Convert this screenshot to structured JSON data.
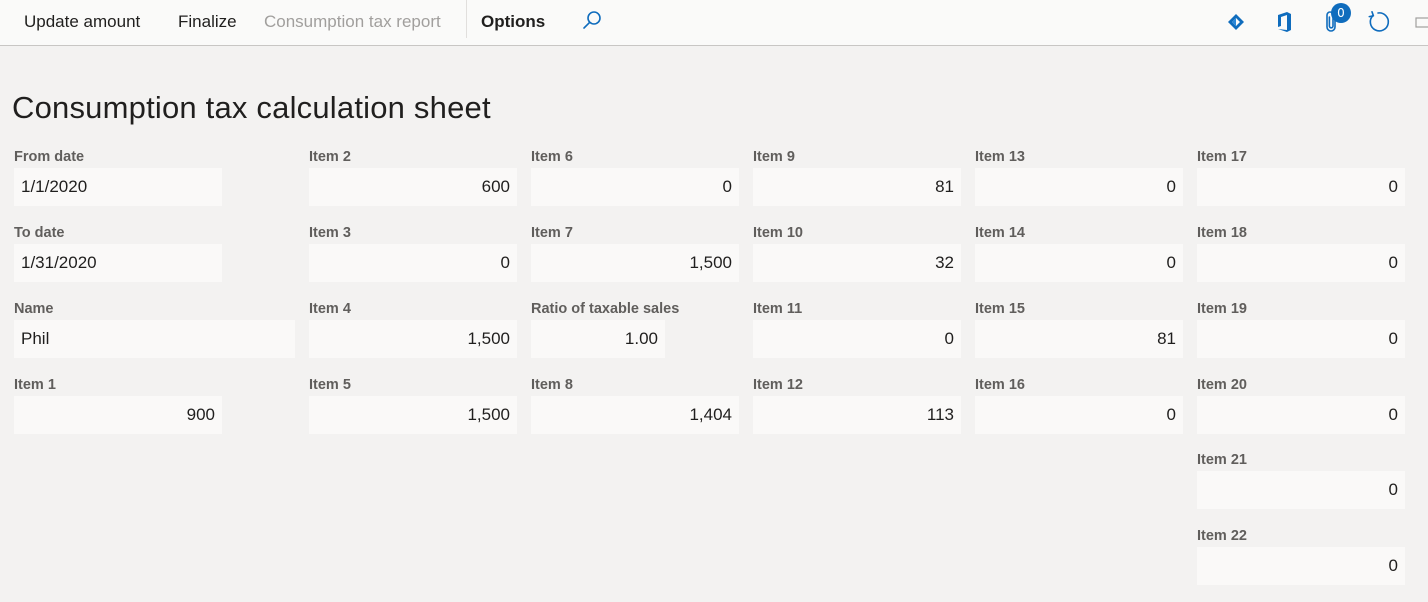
{
  "toolbar": {
    "update_amount": "Update amount",
    "finalize": "Finalize",
    "consumption_tax_report": "Consumption tax report",
    "options": "Options",
    "attachments_count": "0"
  },
  "page": {
    "title": "Consumption tax calculation sheet"
  },
  "fields": {
    "from_date": {
      "label": "From date",
      "value": "1/1/2020"
    },
    "to_date": {
      "label": "To date",
      "value": "1/31/2020"
    },
    "name": {
      "label": "Name",
      "value": "Phil"
    },
    "item1": {
      "label": "Item 1",
      "value": "900"
    },
    "item2": {
      "label": "Item 2",
      "value": "600"
    },
    "item3": {
      "label": "Item 3",
      "value": "0"
    },
    "item4": {
      "label": "Item 4",
      "value": "1,500"
    },
    "item5": {
      "label": "Item 5",
      "value": "1,500"
    },
    "item6": {
      "label": "Item 6",
      "value": "0"
    },
    "item7": {
      "label": "Item 7",
      "value": "1,500"
    },
    "ratio": {
      "label": "Ratio of taxable sales",
      "value": "1.00"
    },
    "item8": {
      "label": "Item 8",
      "value": "1,404"
    },
    "item9": {
      "label": "Item 9",
      "value": "81"
    },
    "item10": {
      "label": "Item 10",
      "value": "32"
    },
    "item11": {
      "label": "Item 11",
      "value": "0"
    },
    "item12": {
      "label": "Item 12",
      "value": "113"
    },
    "item13": {
      "label": "Item 13",
      "value": "0"
    },
    "item14": {
      "label": "Item 14",
      "value": "0"
    },
    "item15": {
      "label": "Item 15",
      "value": "81"
    },
    "item16": {
      "label": "Item 16",
      "value": "0"
    },
    "item17": {
      "label": "Item 17",
      "value": "0"
    },
    "item18": {
      "label": "Item 18",
      "value": "0"
    },
    "item19": {
      "label": "Item 19",
      "value": "0"
    },
    "item20": {
      "label": "Item 20",
      "value": "0"
    },
    "item21": {
      "label": "Item 21",
      "value": "0"
    },
    "item22": {
      "label": "Item 22",
      "value": "0"
    }
  },
  "icons": [
    "search-icon",
    "power-apps-icon",
    "office-icon",
    "attachment-icon",
    "refresh-icon",
    "maximize-icon"
  ],
  "colors": {
    "accent": "#0f6cbd",
    "background": "#f3f2f1",
    "field": "#faf9f8"
  }
}
